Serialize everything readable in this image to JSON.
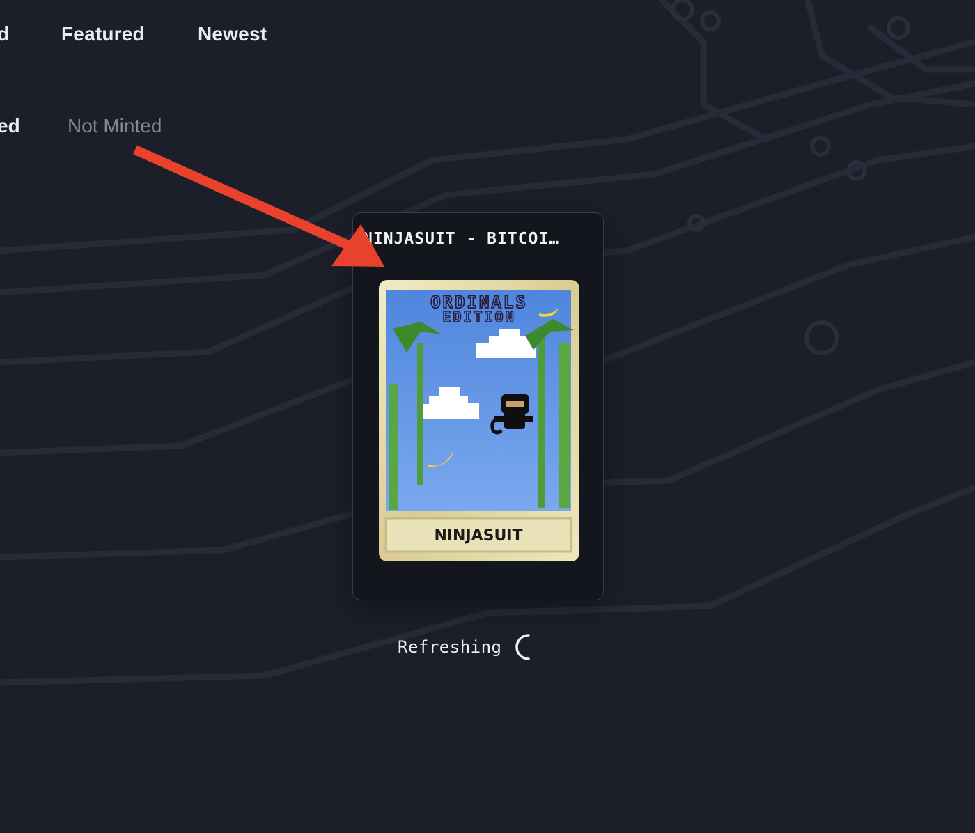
{
  "nav": {
    "tabs": [
      {
        "label": "d"
      },
      {
        "label": "Featured"
      },
      {
        "label": "Newest"
      }
    ]
  },
  "filters": [
    {
      "label": "ed"
    },
    {
      "label": "Not Minted"
    }
  ],
  "card": {
    "title": "NINJASUIT - BITCOI…",
    "art": {
      "banner_line1": "ORDINALS",
      "banner_line2": "EDITION",
      "plate_label": "NINJASUIT"
    }
  },
  "status": {
    "label": "Refreshing"
  },
  "colors": {
    "background": "#1c1f2a",
    "card_bg": "#14161d",
    "arrow": "#e8412c",
    "gold_frame": "#e3d7a4",
    "sky": "#5b8fe0"
  },
  "icons": [
    "annotation-arrow",
    "spinner-icon"
  ]
}
